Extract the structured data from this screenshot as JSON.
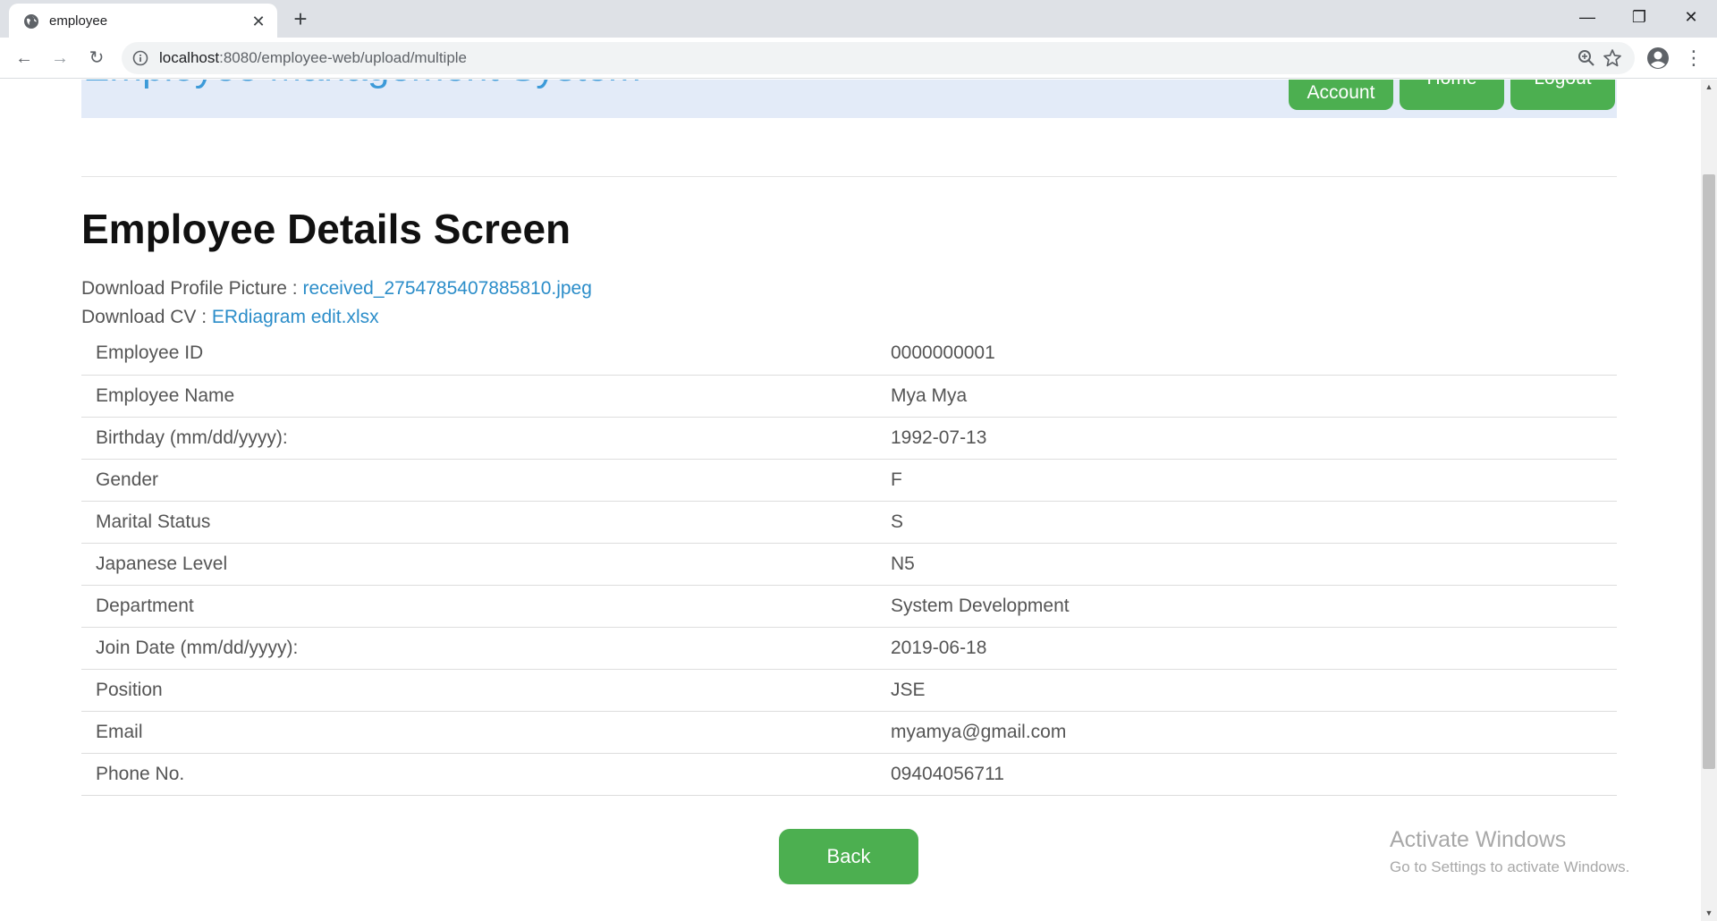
{
  "browser": {
    "tab_title": "employee",
    "new_tab_label": "+",
    "close_tab_label": "✕",
    "url_host": "localhost",
    "url_rest": ":8080/employee-web/upload/multiple",
    "controls": {
      "minimize": "—",
      "maximize": "❐",
      "close": "✕"
    },
    "nav": {
      "back": "←",
      "forward": "→",
      "reload": "↻",
      "menu": "⋮"
    }
  },
  "header": {
    "site_title": "Employee Management System",
    "buttons": {
      "account": "Account",
      "home": "Home",
      "logout": "Logout"
    }
  },
  "page": {
    "title": "Employee Details Screen",
    "downloads": {
      "picture_label": "Download Profile Picture : ",
      "picture_file": "received_2754785407885810.jpeg",
      "cv_label": "Download CV : ",
      "cv_file": "ERdiagram edit.xlsx"
    },
    "details": [
      {
        "label": "Employee ID",
        "value": "0000000001"
      },
      {
        "label": "Employee Name",
        "value": "Mya Mya"
      },
      {
        "label": "Birthday (mm/dd/yyyy):",
        "value": "1992-07-13"
      },
      {
        "label": "Gender",
        "value": "F"
      },
      {
        "label": "Marital Status",
        "value": "S"
      },
      {
        "label": "Japanese Level",
        "value": "N5"
      },
      {
        "label": "Department",
        "value": "System Development"
      },
      {
        "label": "Join Date (mm/dd/yyyy):",
        "value": "2019-06-18"
      },
      {
        "label": "Position",
        "value": "JSE"
      },
      {
        "label": "Email",
        "value": "myamya@gmail.com"
      },
      {
        "label": "Phone No.",
        "value": "09404056711"
      }
    ],
    "back_label": "Back"
  },
  "watermark": {
    "title": "Activate Windows",
    "subtitle": "Go to Settings to activate Windows."
  },
  "colors": {
    "accent_green": "#4caf50",
    "link_blue": "#2b8dc9",
    "header_band": "#e3ebf8",
    "title_blue": "#3c9ad8"
  }
}
